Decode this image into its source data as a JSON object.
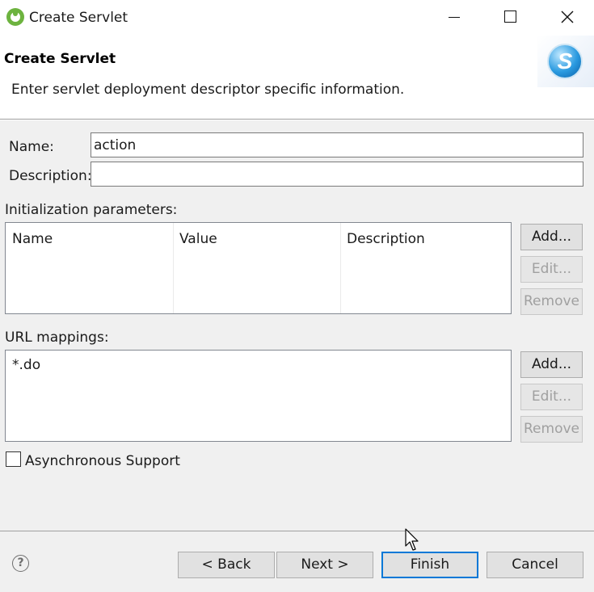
{
  "window": {
    "title": "Create Servlet"
  },
  "header": {
    "title": "Create Servlet",
    "description": "Enter servlet deployment descriptor specific information.",
    "banner_icon": "spring-s-icon"
  },
  "form": {
    "name_label": "Name:",
    "name_value": "action",
    "description_label": "Description:",
    "description_value": ""
  },
  "init_params": {
    "label": "Initialization parameters:",
    "columns": [
      "Name",
      "Value",
      "Description"
    ],
    "rows": [],
    "buttons": {
      "add": "Add...",
      "edit": "Edit...",
      "remove": "Remove"
    }
  },
  "url_mappings": {
    "label": "URL mappings:",
    "items": [
      "*.do"
    ],
    "buttons": {
      "add": "Add...",
      "edit": "Edit...",
      "remove": "Remove"
    }
  },
  "async": {
    "label": "Asynchronous Support",
    "checked": false
  },
  "footer": {
    "help_icon": "help-icon",
    "back": "< Back",
    "next": "Next >",
    "finish": "Finish",
    "cancel": "Cancel"
  },
  "colors": {
    "accent": "#0078d7",
    "dialog_bg": "#f0f0f0",
    "spring_green": "#6db33f"
  }
}
